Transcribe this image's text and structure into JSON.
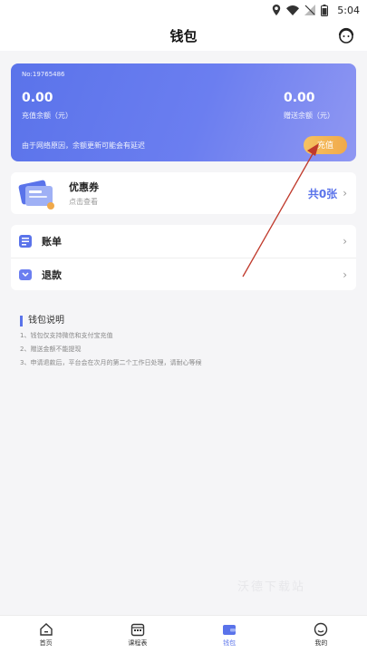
{
  "status_bar": {
    "time": "5:04"
  },
  "header": {
    "title": "钱包"
  },
  "balance_card": {
    "card_no": "No:19765486",
    "recharge_amount": "0.00",
    "recharge_label": "充值余额（元）",
    "gift_amount": "0.00",
    "gift_label": "赠送余额（元）",
    "note": "由于网络原因，余额更新可能会有延迟",
    "recharge_button": "充值"
  },
  "coupon": {
    "title": "优惠券",
    "subtitle": "点击查看",
    "count": "共0张"
  },
  "list": [
    {
      "label": "账单"
    },
    {
      "label": "退款"
    }
  ],
  "wallet_info": {
    "title": "钱包说明",
    "lines": [
      "1、钱包仅支持微信和支付宝充值",
      "2、赠送金额不能提现",
      "3、申请退款后，平台会在次月的第二个工作日处理，请耐心等候"
    ]
  },
  "watermark": "沃德下载站",
  "bottom_nav": [
    {
      "label": "首页",
      "icon": "home-icon"
    },
    {
      "label": "课程表",
      "icon": "schedule-icon"
    },
    {
      "label": "钱包",
      "icon": "wallet-icon",
      "active": true
    },
    {
      "label": "我的",
      "icon": "profile-icon"
    }
  ],
  "colors": {
    "accent": "#5a73ea",
    "recharge_button": "#f0a94a",
    "annotation_arrow": "#c0392b"
  }
}
